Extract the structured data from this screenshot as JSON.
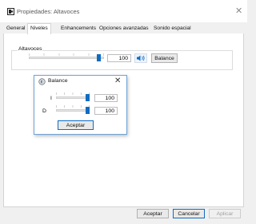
{
  "window": {
    "title": "Propiedades: Altavoces",
    "close_glyph": "✕"
  },
  "tabs": [
    {
      "label": "General",
      "active": false
    },
    {
      "label": "Niveles",
      "active": true
    },
    {
      "label": "Enhancements",
      "active": false
    },
    {
      "label": "Opciones avanzadas",
      "active": false
    },
    {
      "label": "Sonido espacial",
      "active": false
    }
  ],
  "speakers": {
    "group_label": "Altavoces",
    "level": 100,
    "level_text": "100",
    "mute_icon": "speaker-icon",
    "balance_button": "Balance"
  },
  "balance_dialog": {
    "title": "Balance",
    "close_glyph": "✕",
    "channels": [
      {
        "label": "I",
        "value": 100,
        "value_text": "100"
      },
      {
        "label": "D",
        "value": 100,
        "value_text": "100"
      }
    ],
    "accept_button": "Aceptar"
  },
  "footer": {
    "ok": "Aceptar",
    "cancel": "Cancelar",
    "apply": "Aplicar"
  },
  "colors": {
    "accent": "#0f6cc2",
    "dialog_border": "#6fa3d9"
  }
}
